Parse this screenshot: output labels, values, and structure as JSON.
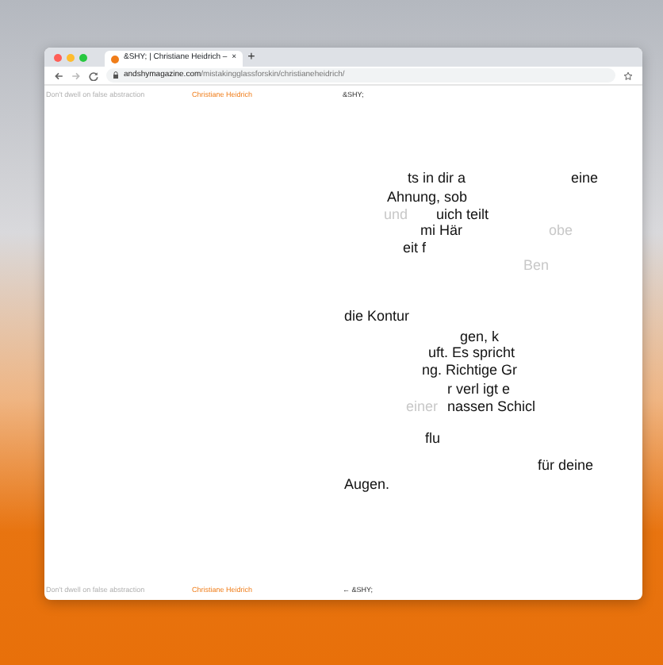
{
  "browser": {
    "tab_title": "&SHY; | Christiane Heidrich – ",
    "tab_close": "×",
    "new_tab": "+",
    "url_domain": "andshymagazine.com",
    "url_path": "/mistakingglassforskin/christianeheidrich/"
  },
  "header": {
    "note": "Don't dwell on false abstraction",
    "author": "Christiane Heidrich",
    "site": "&SHY;"
  },
  "fragments": [
    {
      "text": "ts in dir a",
      "faded": false
    },
    {
      "text": "eine",
      "faded": false
    },
    {
      "text": "Ahnung, sob",
      "faded": false
    },
    {
      "text": "und",
      "faded": true
    },
    {
      "text": "uich teilt",
      "faded": false
    },
    {
      "text": "mi Här",
      "faded": false
    },
    {
      "text": "obe",
      "faded": true
    },
    {
      "text": "eit f",
      "faded": false
    },
    {
      "text": "Ben",
      "faded": true
    },
    {
      "text": "die Kontur",
      "faded": false
    },
    {
      "text": "gen, k",
      "faded": false
    },
    {
      "text": "uft. Es spricht",
      "faded": false
    },
    {
      "text": "ng. Richtige Gr",
      "faded": false
    },
    {
      "text": "r verl igt e",
      "faded": false
    },
    {
      "text": "einer",
      "faded": true
    },
    {
      "text": "nassen Schicl",
      "faded": false
    },
    {
      "text": "flu",
      "faded": false
    },
    {
      "text": "für deine",
      "faded": false
    },
    {
      "text": "Augen.",
      "faded": false
    }
  ],
  "footer": {
    "note": "Don't dwell on false abstraction",
    "author": "Christiane Heidrich",
    "back_link": "← &SHY;"
  }
}
